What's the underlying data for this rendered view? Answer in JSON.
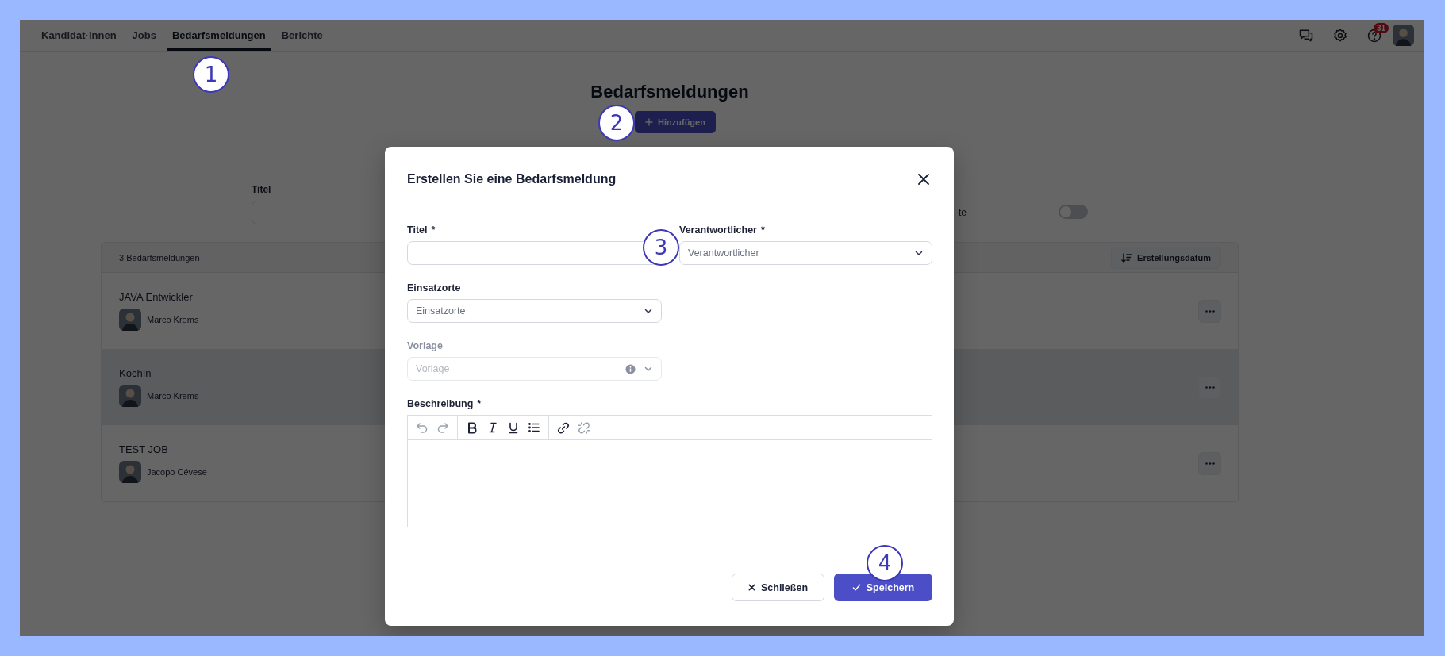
{
  "nav": {
    "tabs": [
      {
        "label": "Kandidat·innen",
        "selected": false
      },
      {
        "label": "Jobs",
        "selected": false
      },
      {
        "label": "Bedarfsmeldungen",
        "selected": true
      },
      {
        "label": "Berichte",
        "selected": false
      }
    ],
    "notification_count": "31"
  },
  "page": {
    "title": "Bedarfsmeldungen",
    "add_button": "Hinzufügen",
    "filters": {
      "title_label": "Titel",
      "cut_label": "te",
      "toggle": {
        "on": false
      }
    }
  },
  "list": {
    "count": "3 Bedarfsmeldungen",
    "sort_button": "Erstellungsdatum",
    "rows": [
      {
        "title": "JAVA Entwickler",
        "person": "Marco Krems",
        "highlighted": false
      },
      {
        "title": "KochIn",
        "person": "Marco Krems",
        "highlighted": true
      },
      {
        "title": "TEST JOB",
        "person": "Jacopo Cévese",
        "highlighted": false
      }
    ]
  },
  "dialog": {
    "title": "Erstellen Sie eine Bedarfsmeldung",
    "fields": [
      {
        "kind": "text",
        "label": "Titel",
        "required_mark": "*",
        "disabled": false
      },
      {
        "kind": "select",
        "label": "Verantwortlicher",
        "required_mark": "*",
        "placeholder": "Verantwortlicher",
        "disabled": false
      },
      {
        "kind": "select",
        "label": "Einsatzorte",
        "placeholder": "Einsatzorte",
        "disabled": false
      },
      {
        "kind": "select",
        "label": "Vorlage",
        "placeholder": "Vorlage",
        "disabled": true
      }
    ],
    "description": {
      "label": "Beschreibung",
      "required_mark": "*",
      "tools": [
        {
          "kind": "undo",
          "disabled": true
        },
        {
          "kind": "redo",
          "disabled": true
        },
        {
          "kind": "bold",
          "disabled": false
        },
        {
          "kind": "italic",
          "disabled": false
        },
        {
          "kind": "underline",
          "disabled": false
        },
        {
          "kind": "list",
          "disabled": false
        },
        {
          "kind": "link",
          "disabled": false
        },
        {
          "kind": "unlink",
          "disabled": true
        }
      ]
    },
    "close_button": "Schließen",
    "save_button": "Speichern"
  },
  "markers": [
    "1",
    "2",
    "3",
    "4"
  ]
}
